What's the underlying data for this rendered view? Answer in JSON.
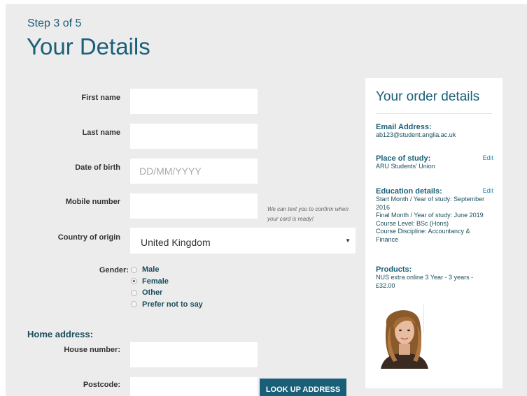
{
  "header": {
    "step": "Step 3 of 5",
    "title": "Your Details"
  },
  "form": {
    "first_name_label": "First name",
    "last_name_label": "Last name",
    "dob_label": "Date of birth",
    "dob_placeholder": "DD/MM/YYYY",
    "mobile_label": "Mobile number",
    "mobile_hint": "We can text you to confirm when your card is ready!",
    "country_label": "Country of origin",
    "country_value": "United Kingdom",
    "gender_label": "Gender:",
    "gender_options": [
      "Male",
      "Female",
      "Other",
      "Prefer not to say"
    ],
    "gender_selected": "Female",
    "home_address_heading": "Home address:",
    "house_number_label": "House number:",
    "postcode_label": "Postcode:",
    "lookup_button": "LOOK UP ADDRESS"
  },
  "order": {
    "title": "Your order details",
    "email_heading": "Email Address:",
    "email_value": "ab123@student.anglia.ac.uk",
    "place_heading": "Place of study:",
    "place_value": "ARU Students' Union",
    "education_heading": "Education details:",
    "education_start": "Start Month / Year of study: September 2016",
    "education_final": "Final Month / Year of study: June 2019",
    "education_level": "Course Level: BSc (Hons)",
    "education_discipline": "Course Discipline: Accountancy & Finance",
    "products_heading": "Products:",
    "products_value": "NUS extra online 3 Year - 3 years - £32.00",
    "edit_label": "Edit"
  },
  "colors": {
    "accent": "#1a5f78",
    "link": "#2a8fb3",
    "page_bg": "#ececec"
  }
}
